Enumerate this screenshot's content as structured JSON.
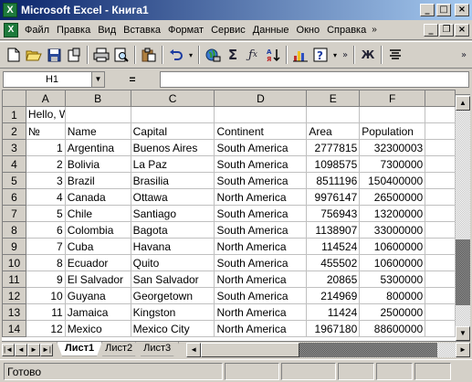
{
  "window": {
    "title": "Microsoft Excel - Книга1",
    "app_icon": "X"
  },
  "menu": {
    "doc_icon": "X",
    "items": [
      "Файл",
      "Правка",
      "Вид",
      "Вставка",
      "Формат",
      "Сервис",
      "Данные",
      "Окно",
      "Справка"
    ],
    "overflow": "»"
  },
  "toolbar": {
    "icons": [
      "new-icon",
      "open-icon",
      "save-icon",
      "permission-icon",
      "print-icon",
      "print-preview-icon",
      "paste-icon",
      "undo-icon",
      "insert-hyperlink-icon",
      "autosum-icon",
      "function-icon",
      "sort-ascending-icon",
      "chart-wizard-icon",
      "help-icon",
      "bold-icon",
      "align-center-icon"
    ],
    "bold_label": "Ж"
  },
  "formula_bar": {
    "name_box": "H1",
    "equals": "=",
    "formula": ""
  },
  "grid": {
    "columns": [
      "A",
      "B",
      "C",
      "D",
      "E",
      "F"
    ],
    "selected_column": "",
    "hello": "Hello, World!",
    "header_row": [
      "№",
      "Name",
      "Capital",
      "Continent",
      "Area",
      "Population"
    ],
    "rows": [
      {
        "row": "1"
      },
      {
        "row": "2"
      },
      {
        "row": "3",
        "cells": [
          "1",
          "Argentina",
          "Buenos Aires",
          "South America",
          "2777815",
          "32300003"
        ]
      },
      {
        "row": "4",
        "cells": [
          "2",
          "Bolivia",
          "La Paz",
          "South America",
          "1098575",
          "7300000"
        ]
      },
      {
        "row": "5",
        "cells": [
          "3",
          "Brazil",
          "Brasilia",
          "South America",
          "8511196",
          "150400000"
        ]
      },
      {
        "row": "6",
        "cells": [
          "4",
          "Canada",
          "Ottawa",
          "North America",
          "9976147",
          "26500000"
        ]
      },
      {
        "row": "7",
        "cells": [
          "5",
          "Chile",
          "Santiago",
          "South America",
          "756943",
          "13200000"
        ]
      },
      {
        "row": "8",
        "cells": [
          "6",
          "Colombia",
          "Bagota",
          "South America",
          "1138907",
          "33000000"
        ]
      },
      {
        "row": "9",
        "cells": [
          "7",
          "Cuba",
          "Havana",
          "North America",
          "114524",
          "10600000"
        ]
      },
      {
        "row": "10",
        "cells": [
          "8",
          "Ecuador",
          "Quito",
          "South America",
          "455502",
          "10600000"
        ]
      },
      {
        "row": "11",
        "cells": [
          "9",
          "El Salvador",
          "San Salvador",
          "North America",
          "20865",
          "5300000"
        ]
      },
      {
        "row": "12",
        "cells": [
          "10",
          "Guyana",
          "Georgetown",
          "South America",
          "214969",
          "800000"
        ]
      },
      {
        "row": "13",
        "cells": [
          "11",
          "Jamaica",
          "Kingston",
          "North America",
          "11424",
          "2500000"
        ]
      },
      {
        "row": "14",
        "cells": [
          "12",
          "Mexico",
          "Mexico City",
          "North America",
          "1967180",
          "88600000"
        ]
      }
    ]
  },
  "sheet_tabs": [
    "Лист1",
    "Лист2",
    "Лист3"
  ],
  "active_sheet": "Лист1",
  "status": {
    "text": "Готово"
  }
}
